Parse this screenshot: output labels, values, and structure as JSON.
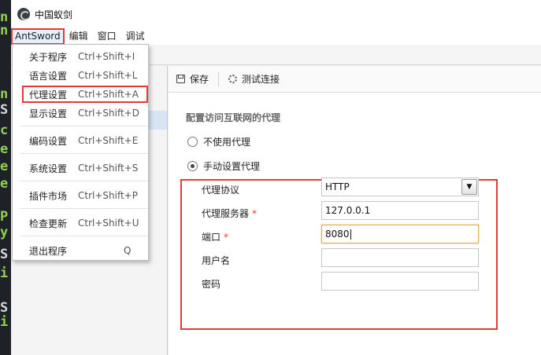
{
  "window": {
    "title": "中国蚁剑"
  },
  "menubar": [
    {
      "label": "AntSword",
      "active": true
    },
    {
      "label": "编辑"
    },
    {
      "label": "窗口"
    },
    {
      "label": "调试"
    }
  ],
  "dropdown": [
    {
      "label": "关于程序",
      "shortcut": "Ctrl+Shift+I"
    },
    {
      "label": "语言设置",
      "shortcut": "Ctrl+Shift+L"
    },
    {
      "label": "代理设置",
      "shortcut": "Ctrl+Shift+A",
      "highlighted": true
    },
    {
      "label": "显示设置",
      "shortcut": "Ctrl+Shift+D"
    },
    {
      "label": "编码设置",
      "shortcut": "Ctrl+Shift+E"
    },
    {
      "label": "系统设置",
      "shortcut": "Ctrl+Shift+S"
    },
    {
      "label": "插件市场",
      "shortcut": "Ctrl+Shift+P"
    },
    {
      "label": "检查更新",
      "shortcut": "Ctrl+Shift+U"
    },
    {
      "label": "退出程序",
      "shortcut": "Q"
    }
  ],
  "toolbar": {
    "save_label": "保存",
    "test_label": "测试连接"
  },
  "proxy": {
    "section_title": "配置访问互联网的代理",
    "no_proxy_label": "不使用代理",
    "manual_label": "手动设置代理",
    "selected": "manual",
    "fields": {
      "protocol": {
        "label": "代理协议",
        "value": "HTTP"
      },
      "server": {
        "label": "代理服务器",
        "value": "127.0.0.1",
        "required": "*"
      },
      "port": {
        "label": "端口",
        "value": "8080",
        "required": "*"
      },
      "username": {
        "label": "用户名",
        "value": ""
      },
      "password": {
        "label": "密码",
        "value": ""
      }
    }
  },
  "colors": {
    "highlight": "#e53935",
    "focus": "#e3a849"
  }
}
